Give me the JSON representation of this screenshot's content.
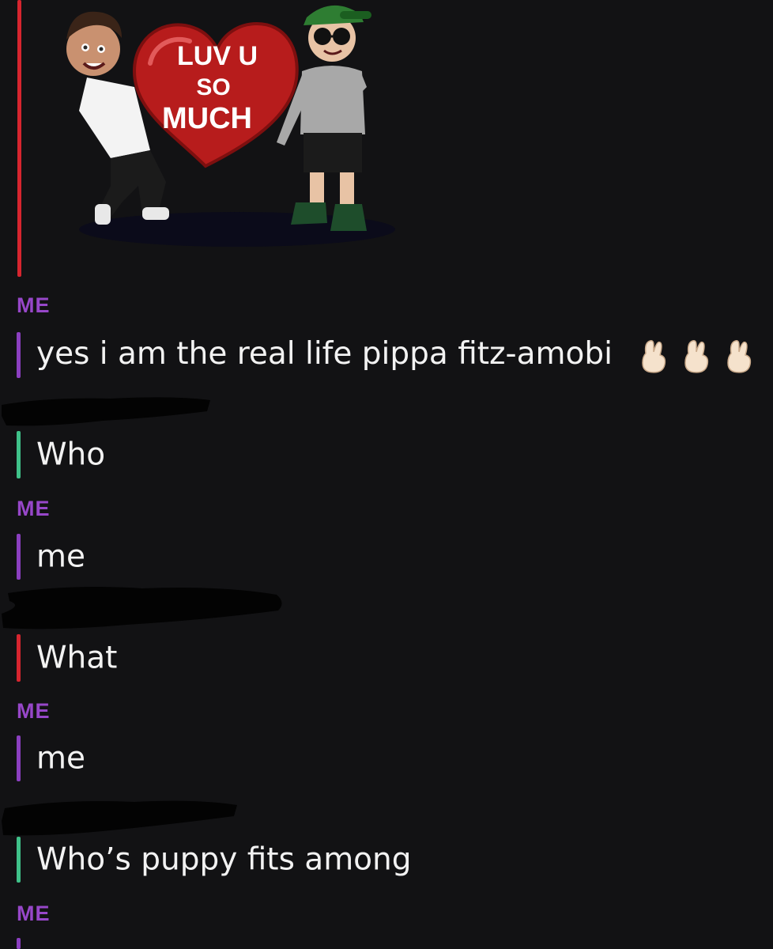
{
  "colors": {
    "background": "#121214",
    "me_label": "#9747c9",
    "me_bar": "#8b3fc0",
    "friend_green_bar": "#3fc189",
    "friend_red_bar": "#d6252f"
  },
  "sticker": {
    "icon": "bitmoji-love-heart-sticker",
    "heart_line1": "LUV U",
    "heart_line2": "SO",
    "heart_line3": "MUCH"
  },
  "messages": [
    {
      "sender": "ME",
      "text": "yes i am the real life pippa fitz-amobi",
      "emoji": [
        "fingers-crossed-icon",
        "fingers-crossed-icon",
        "fingers-crossed-icon"
      ]
    },
    {
      "sender": "",
      "text": "Who"
    },
    {
      "sender": "ME",
      "text": "me"
    },
    {
      "sender": "",
      "text": "What"
    },
    {
      "sender": "ME",
      "text": "me"
    },
    {
      "sender": "",
      "text": "Who’s puppy fits among"
    },
    {
      "sender": "ME",
      "text": ""
    }
  ]
}
